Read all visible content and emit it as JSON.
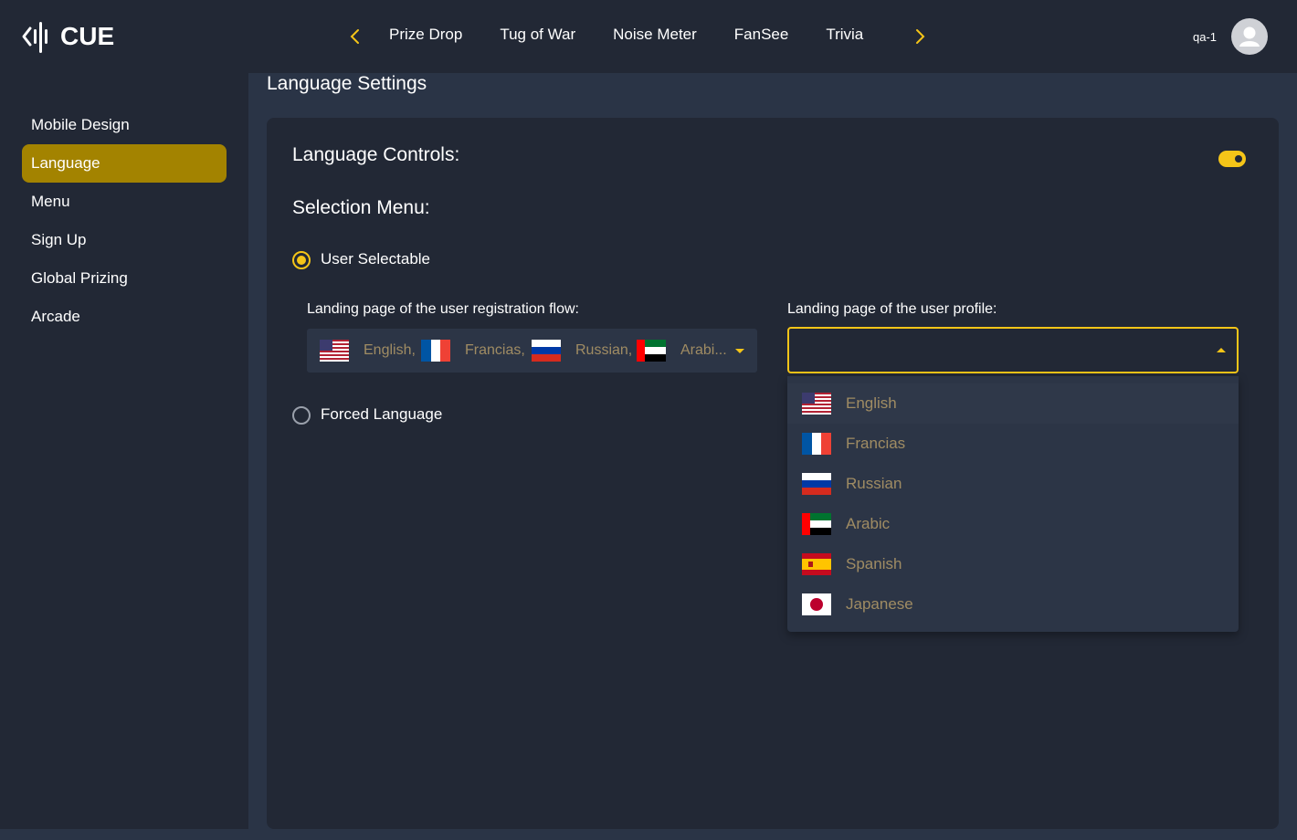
{
  "header": {
    "logo_text": "CUE",
    "nav_tabs": [
      "Prize Drop",
      "Tug of War",
      "Noise Meter",
      "FanSee",
      "Trivia"
    ],
    "user_name": "qa-1",
    "accent_color": "#f5c518"
  },
  "sidebar": {
    "items": [
      {
        "label": "Mobile Design",
        "active": false
      },
      {
        "label": "Language",
        "active": true
      },
      {
        "label": "Menu",
        "active": false
      },
      {
        "label": "Sign Up",
        "active": false
      },
      {
        "label": "Global Prizing",
        "active": false
      },
      {
        "label": "Arcade",
        "active": false
      }
    ]
  },
  "main": {
    "page_title": "Language Settings",
    "language_controls_label": "Language Controls:",
    "language_controls_enabled": true,
    "selection_menu_label": "Selection Menu:",
    "options": {
      "user_selectable": {
        "label": "User Selectable",
        "checked": true
      },
      "forced_language": {
        "label": "Forced Language",
        "checked": false
      }
    },
    "registration_flow": {
      "label": "Landing page of the user registration flow:",
      "chips": [
        {
          "text": "English,",
          "flag": "us-flag"
        },
        {
          "text": "Francias,",
          "flag": "fr-flag"
        },
        {
          "text": "Russian,",
          "flag": "ru-flag"
        },
        {
          "text": "Arabi...",
          "flag": "ae-flag"
        }
      ]
    },
    "user_profile": {
      "label": "Landing page of the user profile:",
      "value": "",
      "open": true
    }
  },
  "dropdown": {
    "options": [
      {
        "label": "English",
        "flag": "us-flag"
      },
      {
        "label": "Francias",
        "flag": "fr-flag"
      },
      {
        "label": "Russian",
        "flag": "ru-flag"
      },
      {
        "label": "Arabic",
        "flag": "ae-flag"
      },
      {
        "label": "Spanish",
        "flag": "es-flag"
      },
      {
        "label": "Japanese",
        "flag": "jp-flag"
      }
    ]
  }
}
